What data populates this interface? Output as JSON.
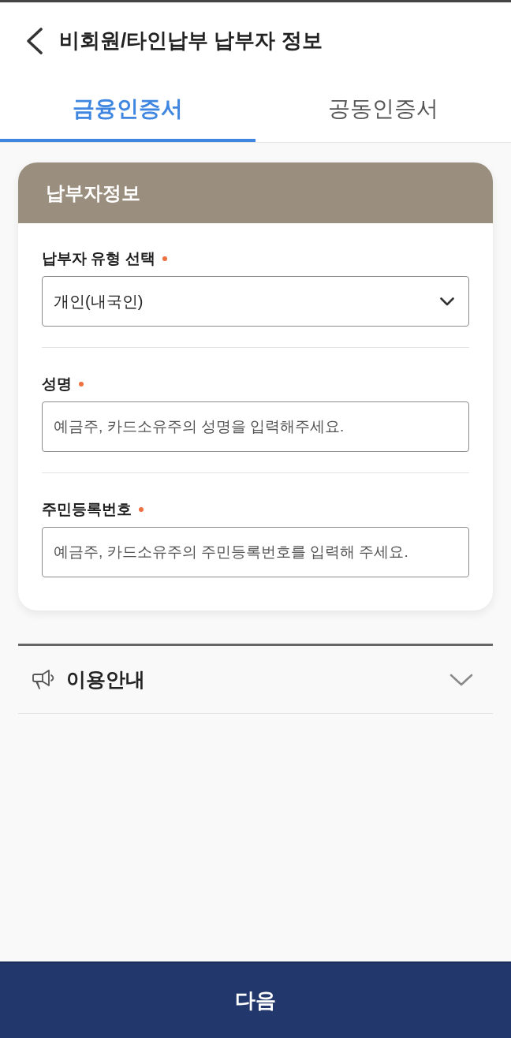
{
  "header": {
    "title": "비회원/타인납부 납부자 정보"
  },
  "tabs": [
    {
      "label": "금융인증서",
      "selected": true
    },
    {
      "label": "공동인증서",
      "selected": false
    }
  ],
  "card": {
    "title": "납부자정보",
    "fields": [
      {
        "kind": "select",
        "label": "납부자 유형 선택",
        "required": true,
        "value": "개인(내국인)"
      },
      {
        "kind": "input",
        "label": "성명",
        "required": true,
        "placeholder": "예금주, 카드소유주의 성명을 입력해주세요."
      },
      {
        "kind": "input",
        "label": "주민등록번호",
        "required": true,
        "placeholder": "예금주, 카드소유주의 주민등록번호를 입력해 주세요."
      }
    ]
  },
  "guide": {
    "title": "이용안내",
    "expanded": false
  },
  "next_button": {
    "label": "다음"
  }
}
